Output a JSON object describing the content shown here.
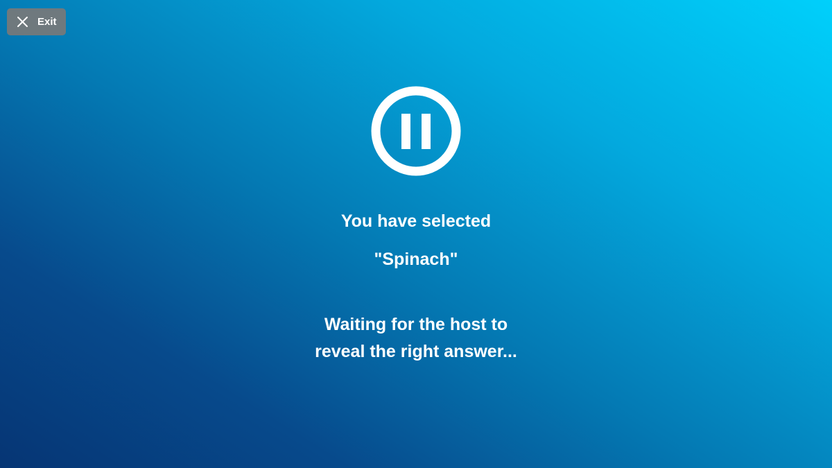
{
  "header": {
    "exit_label": "Exit",
    "exit_icon": "close-icon"
  },
  "status": {
    "icon": "pause-circle-icon",
    "selected_label": "You have selected",
    "selected_answer": "\"Spinach\"",
    "waiting_line_1": "Waiting for the host to",
    "waiting_line_2": "reveal the right answer..."
  },
  "colors": {
    "gradient_light": "#00d0fb",
    "gradient_dark": "#063574",
    "exit_button_bg": "#787878",
    "text": "#ffffff"
  }
}
